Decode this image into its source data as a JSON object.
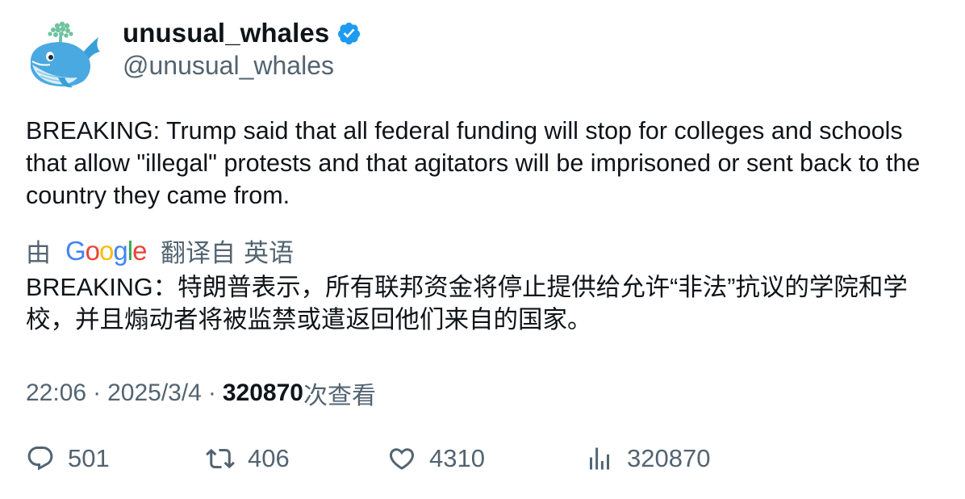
{
  "author": {
    "display_name": "unusual_whales",
    "handle": "@unusual_whales",
    "verified": true,
    "avatar_icon": "whale-avatar-icon",
    "verified_color": "#1d9bf0"
  },
  "tweet": {
    "text": "BREAKING: Trump said that all federal funding will stop for colleges and schools that allow \"illegal\" protests and that agitators will be imprisoned or sent back to the country they came from."
  },
  "translation": {
    "by_label": "由",
    "provider_logo": "google-logo",
    "translated_from": "翻译自",
    "source_language": "英语",
    "text": "BREAKING：特朗普表示，所有联邦资金将停止提供给允许“非法”抗议的学院和学校，并且煽动者将被监禁或遣返回他们来自的国家。"
  },
  "meta": {
    "time": "22:06",
    "separator": "·",
    "date": "2025/3/4",
    "views_count": "320870",
    "views_label": "次查看"
  },
  "actions": {
    "replies": "501",
    "retweets": "406",
    "likes": "4310",
    "views": "320870"
  },
  "colors": {
    "text_primary": "#0f1419",
    "text_secondary": "#536471",
    "accent": "#1d9bf0"
  }
}
